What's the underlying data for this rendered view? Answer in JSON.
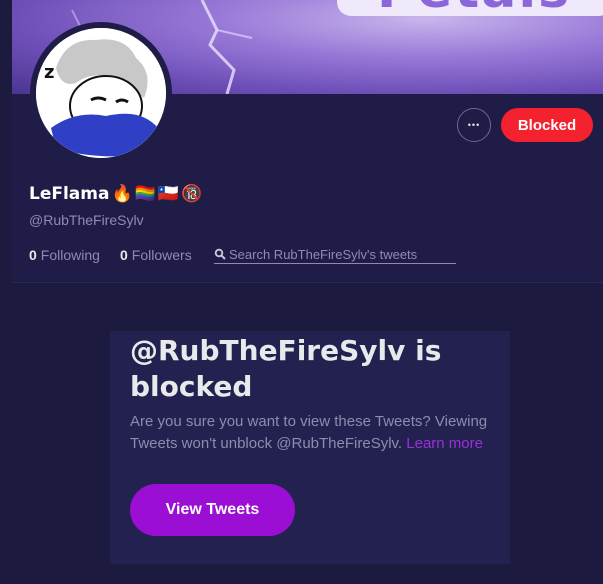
{
  "profile": {
    "display_name": "LeFlama",
    "name_emojis": [
      "🔥",
      "🏳️‍🌈",
      "🇨🇱",
      "🔞"
    ],
    "handle": "@RubTheFireSylv",
    "following_count": "0",
    "following_label": "Following",
    "followers_count": "0",
    "followers_label": "Followers"
  },
  "banner": {
    "text": "Petals"
  },
  "actions": {
    "more_label": "•••",
    "blocked_label": "Blocked"
  },
  "search": {
    "placeholder": "Search RubTheFireSylv's tweets"
  },
  "blocked_notice": {
    "title": "@RubTheFireSylv is blocked",
    "description": "Are you sure you want to view these Tweets? Viewing Tweets won't unblock @RubTheFireSylv.",
    "learn_more": "Learn more",
    "view_tweets_label": "View Tweets"
  },
  "colors": {
    "background": "#1c1a3f",
    "blocked_button": "#f4212e",
    "accent": "#9b0fd4",
    "link": "#9b30d9"
  }
}
